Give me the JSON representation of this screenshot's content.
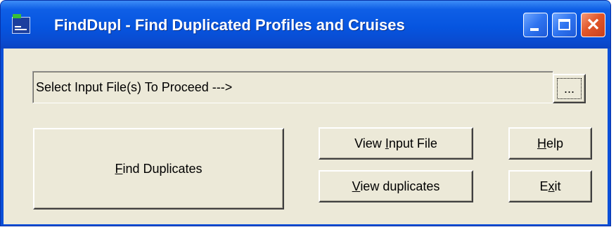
{
  "window": {
    "title": "FindDupl - Find Duplicated Profiles and Cruises",
    "icon": "app-icon",
    "caption_buttons": {
      "minimize": "minimize-icon",
      "maximize": "maximize-icon",
      "close": "✕"
    }
  },
  "file_select": {
    "prompt": "Select Input File(s) To Proceed --->",
    "browse_label": "..."
  },
  "buttons": {
    "find_duplicates": {
      "pre": "",
      "key": "F",
      "post": "ind Duplicates"
    },
    "view_input_file": {
      "pre": "View ",
      "key": "I",
      "post": "nput File"
    },
    "view_duplicates": {
      "pre": "",
      "key": "V",
      "post": "iew duplicates"
    },
    "help": {
      "pre": "",
      "key": "H",
      "post": "elp"
    },
    "exit": {
      "pre": "E",
      "key": "x",
      "post": "it"
    }
  },
  "colors": {
    "titlebar": "#0655e0",
    "client": "#ece9d8",
    "close_button": "#e2572a"
  }
}
